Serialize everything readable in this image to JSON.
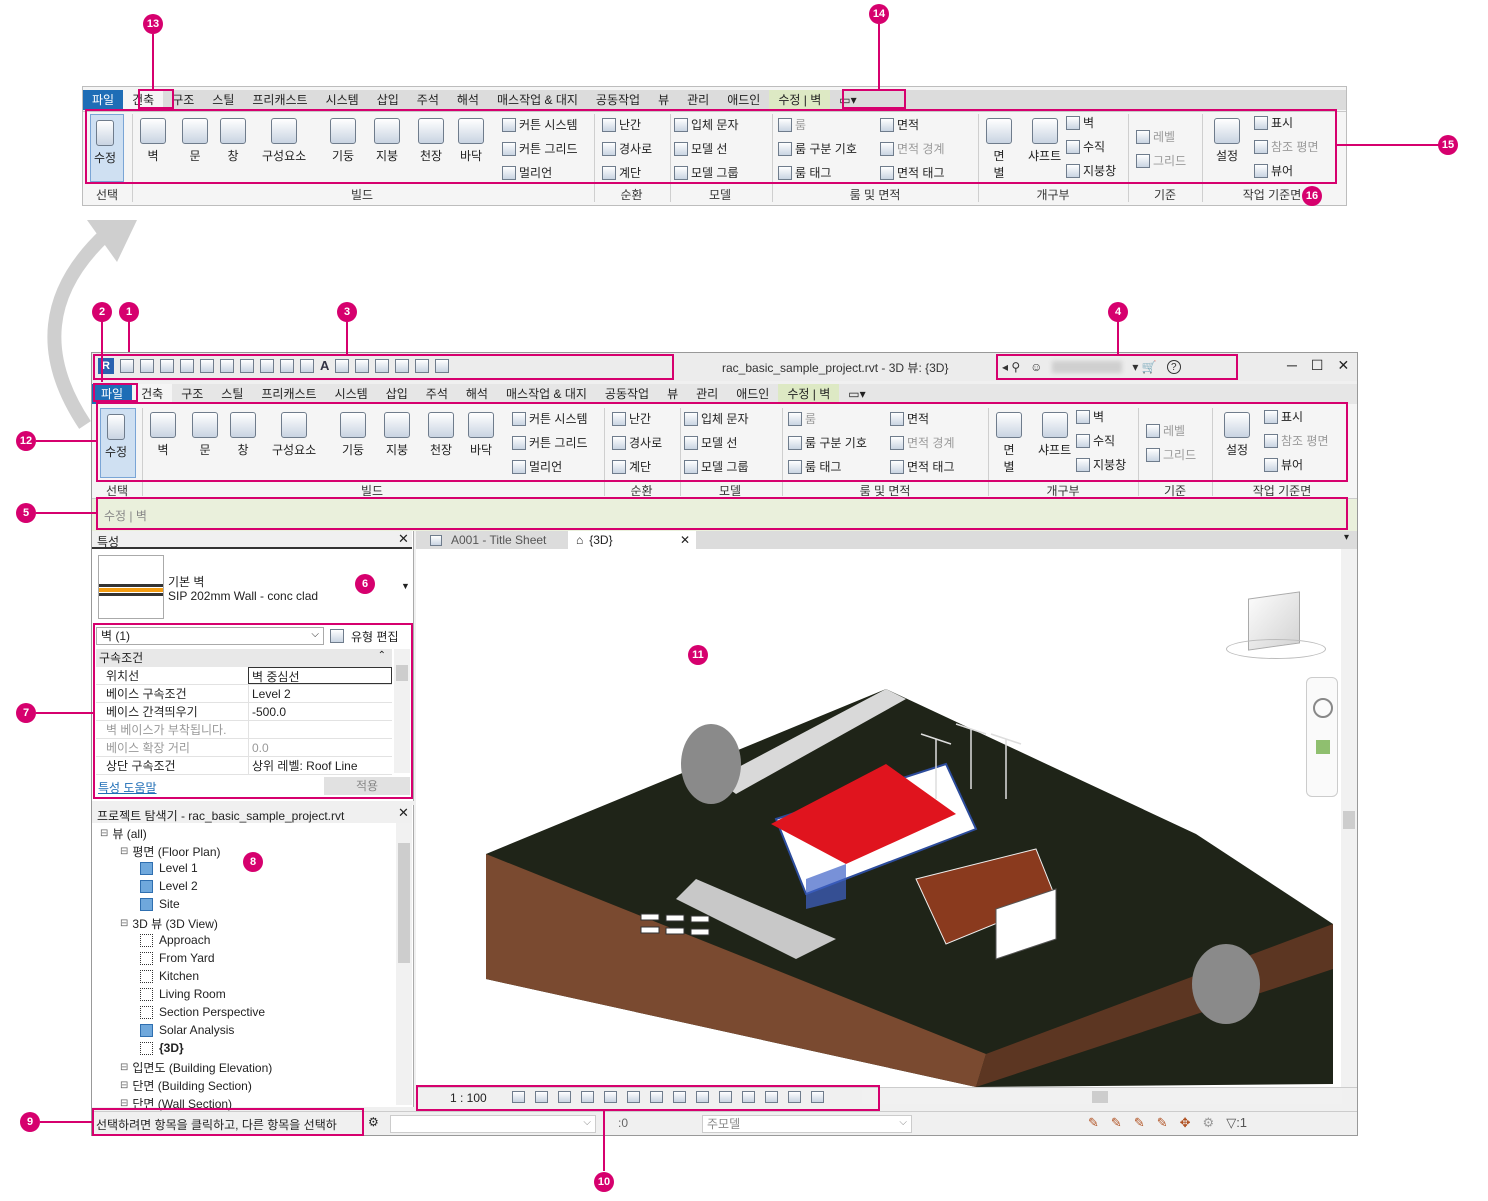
{
  "top_ribbon": {
    "tabs": [
      "파일",
      "건축",
      "구조",
      "스틸",
      "프리캐스트",
      "시스템",
      "삽입",
      "주석",
      "해석",
      "매스작업 & 대지",
      "공동작업",
      "뷰",
      "관리",
      "애드인",
      "수정 | 벽"
    ],
    "select": {
      "button": "수정",
      "panel": "선택"
    },
    "build": {
      "buttons": [
        "벽",
        "문",
        "창",
        "구성요소",
        "기둥",
        "지붕",
        "천장",
        "바닥"
      ],
      "small": [
        "커튼 시스템",
        "커튼 그리드",
        "멀리언"
      ],
      "panel": "빌드"
    },
    "circulation": {
      "items": [
        "난간",
        "경사로",
        "계단"
      ],
      "panel": "순환"
    },
    "model": {
      "items": [
        "입체 문자",
        "모델 선",
        "모델 그룹"
      ],
      "panel": "모델"
    },
    "room": {
      "col1": [
        "룸",
        "룸 구분 기호",
        "룸 태그"
      ],
      "col2": [
        "면적",
        "면적 경계",
        "면적 태그"
      ],
      "panel": "룸 및 면적"
    },
    "opening": {
      "big": [
        "면\n별",
        "샤프트"
      ],
      "small": [
        "벽",
        "수직",
        "지붕창"
      ],
      "panel": "개구부"
    },
    "datum": {
      "items": [
        "레벨",
        "그리드"
      ],
      "panel": "기준"
    },
    "workplane": {
      "big": "설정",
      "small": [
        "표시",
        "참조 평면",
        "뷰어"
      ],
      "panel": "작업 기준면"
    }
  },
  "title_bar": {
    "title": "rac_basic_sample_project.rvt - 3D 뷰: {3D}"
  },
  "options_bar": {
    "text": "수정 | 벽"
  },
  "properties": {
    "header": "특성",
    "type_family": "기본 벽",
    "type_name": "SIP 202mm Wall - conc clad",
    "selector": "벽 (1)",
    "edit_type": "유형 편집",
    "group": "구속조건",
    "rows": [
      {
        "k": "위치선",
        "v": "벽 중심선"
      },
      {
        "k": "베이스 구속조건",
        "v": "Level 2"
      },
      {
        "k": "베이스 간격띄우기",
        "v": "-500.0"
      },
      {
        "k": "벽 베이스가 부착됩니다.",
        "v": ""
      },
      {
        "k": "베이스 확장 거리",
        "v": "0.0"
      },
      {
        "k": "상단 구속조건",
        "v": "상위 레벨: Roof Line"
      }
    ],
    "help": "특성 도움말",
    "apply": "적용"
  },
  "browser": {
    "header": "프로젝트 탐색기 - rac_basic_sample_project.rvt",
    "items": [
      {
        "t": "뷰 (all)",
        "lvl": 0
      },
      {
        "t": "평면 (Floor Plan)",
        "lvl": 1
      },
      {
        "t": "Level 1",
        "lvl": 2,
        "icon": "blue"
      },
      {
        "t": "Level 2",
        "lvl": 2,
        "icon": "blue"
      },
      {
        "t": "Site",
        "lvl": 2,
        "icon": "blue"
      },
      {
        "t": "3D 뷰 (3D View)",
        "lvl": 1
      },
      {
        "t": "Approach",
        "lvl": 2,
        "icon": "dot"
      },
      {
        "t": "From Yard",
        "lvl": 2,
        "icon": "dot"
      },
      {
        "t": "Kitchen",
        "lvl": 2,
        "icon": "dot"
      },
      {
        "t": "Living Room",
        "lvl": 2,
        "icon": "dot"
      },
      {
        "t": "Section Perspective",
        "lvl": 2,
        "icon": "dot"
      },
      {
        "t": "Solar Analysis",
        "lvl": 2,
        "icon": "blue"
      },
      {
        "t": "{3D}",
        "lvl": 2,
        "icon": "dot",
        "bold": true
      },
      {
        "t": "입면도 (Building Elevation)",
        "lvl": 1
      },
      {
        "t": "단면 (Building Section)",
        "lvl": 1
      },
      {
        "t": "단면 (Wall Section)",
        "lvl": 1
      }
    ]
  },
  "view_tabs": [
    "A001 - Title Sheet",
    "{3D}"
  ],
  "view_control": {
    "scale": "1 : 100"
  },
  "status": {
    "text": "선택하려면 항목을 클릭하고, 다른 항목을 선택하",
    "count": ":0",
    "model": "주모델",
    "filter": ":1"
  },
  "callouts": [
    "1",
    "2",
    "3",
    "4",
    "5",
    "6",
    "7",
    "8",
    "9",
    "10",
    "11",
    "12",
    "13",
    "14",
    "15",
    "16"
  ],
  "colors": {
    "accent": "#d6006e",
    "file_tab": "#1e6db6",
    "context_tab": "#dde9c4",
    "roof": "#e0141e",
    "ground": "#1f2418"
  }
}
